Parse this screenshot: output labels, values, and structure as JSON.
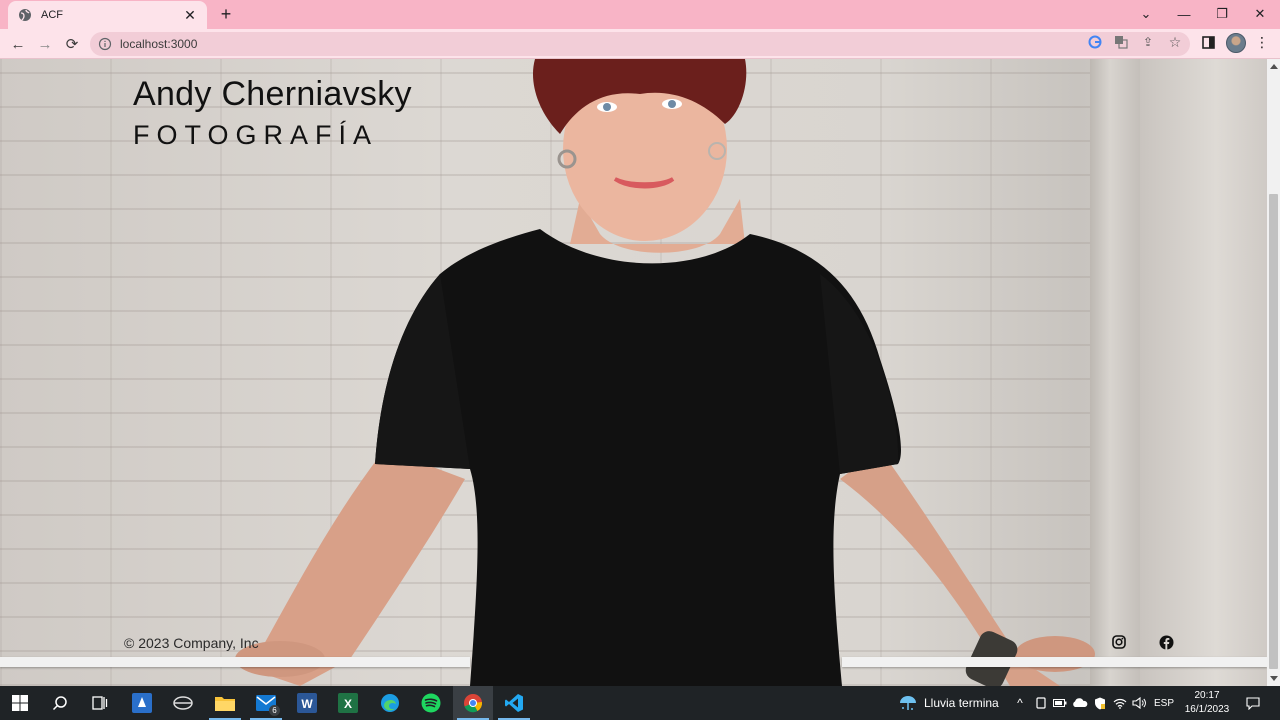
{
  "browser": {
    "tab_title": "ACF",
    "url": "localhost:3000",
    "tab_close_icon": "close-icon",
    "new_tab_icon": "plus-icon"
  },
  "page": {
    "brand_name": "Andy Cherniavsky",
    "brand_subtitle": "FOTOGRAFÍA",
    "copyright": "© 2023 Company, Inc",
    "social": [
      "instagram-icon",
      "facebook-icon"
    ]
  },
  "taskbar": {
    "weather_text": "Lluvia termina",
    "language": "ESP",
    "time": "20:17",
    "date": "16/1/2023",
    "mail_badge": "6"
  },
  "colors": {
    "tab_strip": "#f8b4c6",
    "toolbar": "#fde3ea",
    "taskbar": "#1f2326"
  }
}
